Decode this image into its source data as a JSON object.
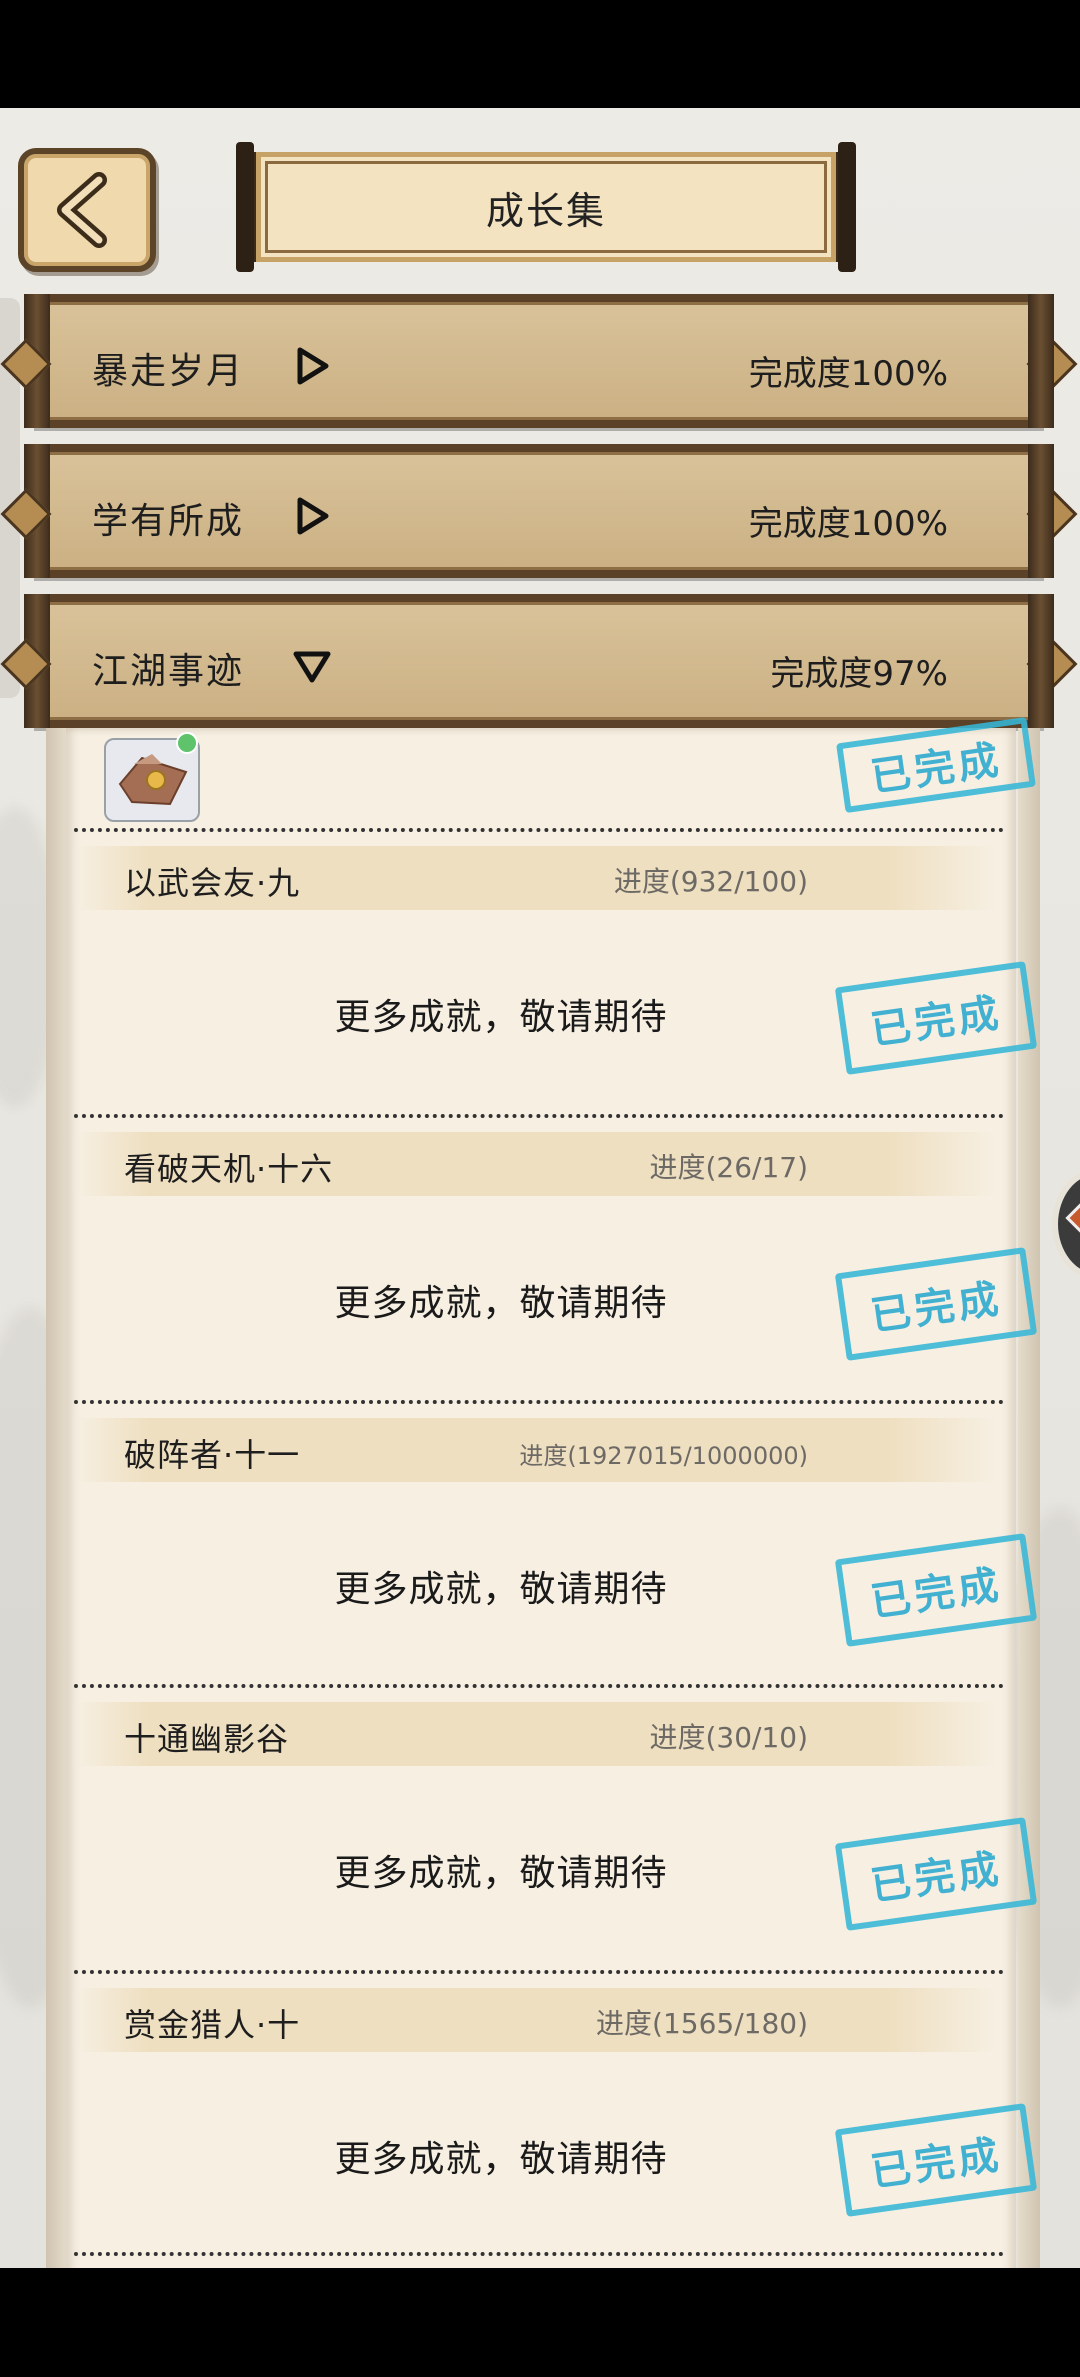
{
  "header": {
    "title": "成长集"
  },
  "categories": [
    {
      "name": "暴走岁月",
      "progress": "完成度100%",
      "expanded": false
    },
    {
      "name": "学有所成",
      "progress": "完成度100%",
      "expanded": false
    },
    {
      "name": "江湖事迹",
      "progress": "完成度97%",
      "expanded": true
    }
  ],
  "achievements": [
    {
      "name": "以武会友·九",
      "progress": "进度(932/100)",
      "reward_text": "更多成就，敬请期待",
      "stamp": "已完成"
    },
    {
      "name": "看破天机·十六",
      "progress": "进度(26/17)",
      "reward_text": "更多成就，敬请期待",
      "stamp": "已完成"
    },
    {
      "name": "破阵者·十一",
      "progress": "进度(1927015/1000000)",
      "reward_text": "更多成就，敬请期待",
      "stamp": "已完成"
    },
    {
      "name": "十通幽影谷",
      "progress": "进度(30/10)",
      "reward_text": "更多成就，敬请期待",
      "stamp": "已完成"
    },
    {
      "name": "赏金猎人·十",
      "progress": "进度(1565/180)",
      "reward_text": "更多成就，敬请期待",
      "stamp": "已完成"
    }
  ],
  "top_item": {
    "stamp": "已完成"
  },
  "colors": {
    "stamp": "#37b7d7",
    "header_wood": "#5a4128",
    "panel": "#f6efe2"
  },
  "icons": {
    "back": "back-arrow-icon",
    "collapsed": "play-triangle-icon",
    "expanded": "down-triangle-icon"
  }
}
